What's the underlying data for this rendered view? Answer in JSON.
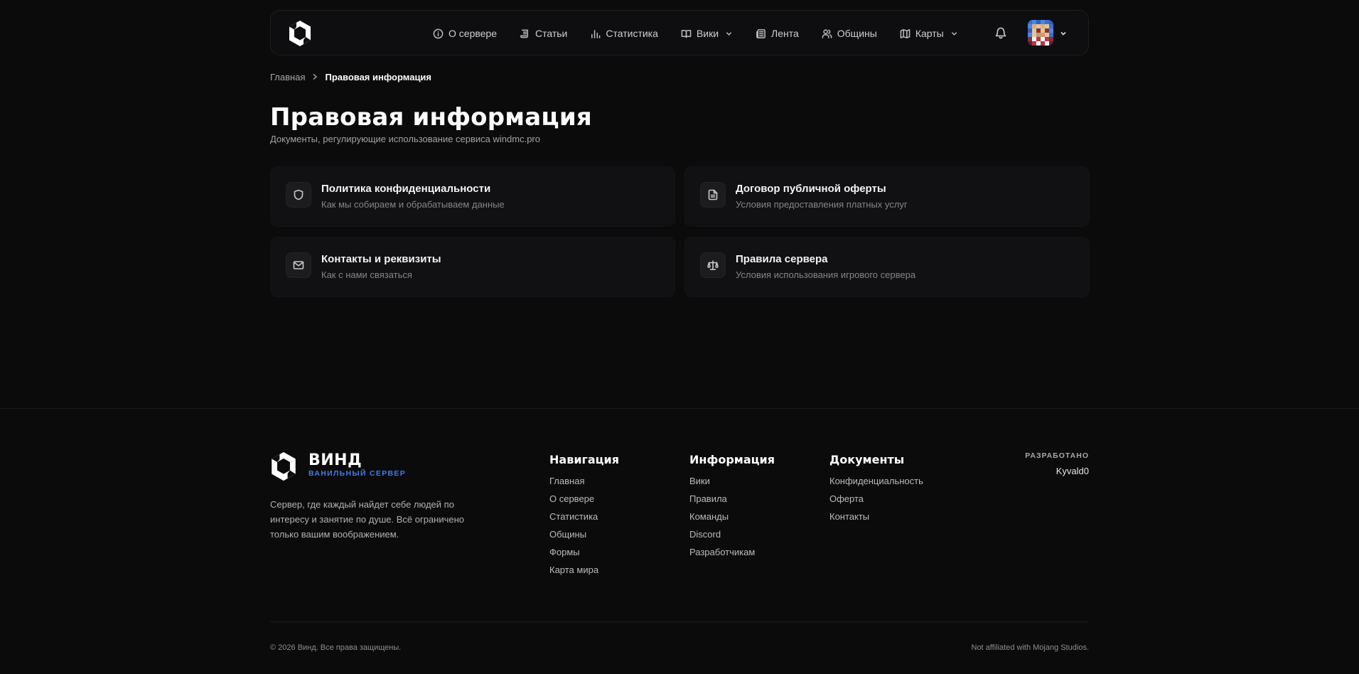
{
  "header": {
    "nav": [
      {
        "label": "О сервере",
        "icon": "info-icon"
      },
      {
        "label": "Статьи",
        "icon": "scroll-icon"
      },
      {
        "label": "Статистика",
        "icon": "bar-chart-icon"
      },
      {
        "label": "Вики",
        "icon": "book-icon",
        "dropdown": true
      },
      {
        "label": "Лента",
        "icon": "newspaper-icon"
      },
      {
        "label": "Общины",
        "icon": "users-icon"
      },
      {
        "label": "Карты",
        "icon": "map-icon",
        "dropdown": true
      }
    ]
  },
  "breadcrumb": {
    "home": "Главная",
    "current": "Правовая информация"
  },
  "page": {
    "title": "Правовая информация",
    "subtitle": "Документы, регулирующие использование сервиса windmc.pro"
  },
  "cards": [
    {
      "title": "Политика конфиденциальности",
      "desc": "Как мы собираем и обрабатываем данные",
      "icon": "shield-icon"
    },
    {
      "title": "Договор публичной оферты",
      "desc": "Условия предоставления платных услуг",
      "icon": "document-icon"
    },
    {
      "title": "Контакты и реквизиты",
      "desc": "Как с нами связаться",
      "icon": "mail-icon"
    },
    {
      "title": "Правила сервера",
      "desc": "Условия использования игрового сервера",
      "icon": "scales-icon"
    }
  ],
  "footer": {
    "brand": "ВИНД",
    "tagline": "ВАНИЛЬНЫЙ СЕРВЕР",
    "description": "Сервер, где каждый найдет себе людей по интересу и занятие по душе. Всё ограничено только вашим воображением.",
    "columns": [
      {
        "title": "Навигация",
        "links": [
          "Главная",
          "О сервере",
          "Статистика",
          "Общины",
          "Формы",
          "Карта мира"
        ]
      },
      {
        "title": "Информация",
        "links": [
          "Вики",
          "Правила",
          "Команды",
          "Discord",
          "Разработчикам"
        ]
      },
      {
        "title": "Документы",
        "links": [
          "Конфиденциальность",
          "Оферта",
          "Контакты"
        ]
      }
    ],
    "dev_label": "РАЗРАБОТАНО",
    "dev_name": "Kyvald0",
    "copyright": "© 2026 Винд. Все права защищены.",
    "affiliation": "Not affiliated with Mojang Studios."
  },
  "colors": {
    "background": "#0b0b0c",
    "accent": "#3d7ef0",
    "card": "#111113"
  }
}
